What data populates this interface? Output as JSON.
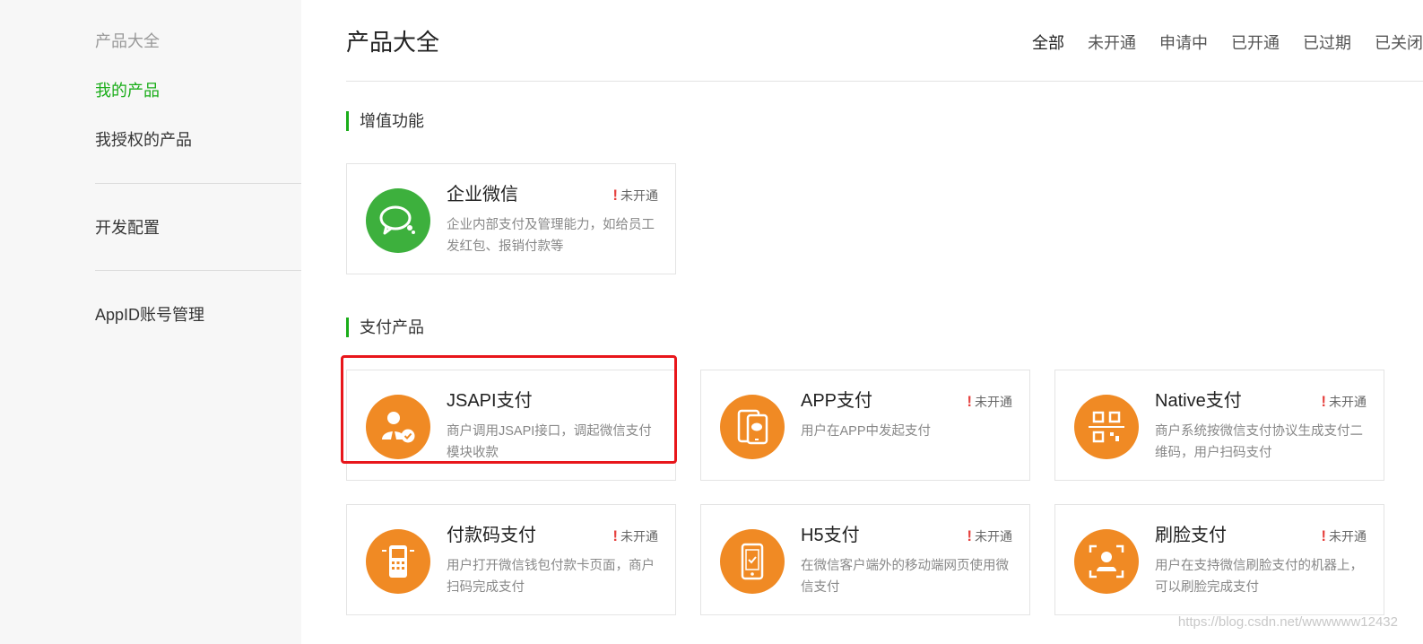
{
  "sidebar": {
    "items": [
      {
        "label": "产品大全",
        "color": "#999999"
      },
      {
        "label": "我的产品",
        "color": "#1aad19",
        "active": true
      },
      {
        "label": "我授权的产品",
        "color": "#353535"
      },
      {
        "label": "开发配置",
        "color": "#353535"
      },
      {
        "label": "AppID账号管理",
        "color": "#353535"
      }
    ]
  },
  "header": {
    "title": "产品大全",
    "filters": [
      "全部",
      "未开通",
      "申请中",
      "已开通",
      "已过期",
      "已关闭"
    ]
  },
  "sections": [
    {
      "title": "增值功能",
      "cards": [
        {
          "title": "企业微信",
          "status": "未开通",
          "desc": "企业内部支付及管理能力，如给员工发红包、报销付款等",
          "icon": "wecom-chat-icon"
        }
      ]
    },
    {
      "title": "支付产品",
      "cards": [
        {
          "title": "JSAPI支付",
          "status": "",
          "desc": "商户调用JSAPI接口，调起微信支付模块收款",
          "icon": "jsapi-user-icon"
        },
        {
          "title": "APP支付",
          "status": "未开通",
          "desc": "用户在APP中发起支付",
          "icon": "mobile-app-icon"
        },
        {
          "title": "Native支付",
          "status": "未开通",
          "desc": "商户系统按微信支付协议生成支付二维码，用户扫码支付",
          "icon": "qr-scan-icon"
        },
        {
          "title": "付款码支付",
          "status": "未开通",
          "desc": "用户打开微信钱包付款卡页面，商户扫码完成支付",
          "icon": "pos-terminal-icon"
        },
        {
          "title": "H5支付",
          "status": "未开通",
          "desc": "在微信客户端外的移动端网页使用微信支付",
          "icon": "h5-phone-icon"
        },
        {
          "title": "刷脸支付",
          "status": "未开通",
          "desc": "用户在支持微信刷脸支付的机器上，可以刷脸完成支付",
          "icon": "face-scan-icon"
        }
      ]
    }
  ],
  "watermark": "https://blog.csdn.net/wwwwww12432",
  "colors": {
    "accent": "#1aad19",
    "icon_orange": "#f08a24",
    "icon_green": "#3db03d",
    "alert": "#e64340",
    "highlight": "#e8161b"
  }
}
